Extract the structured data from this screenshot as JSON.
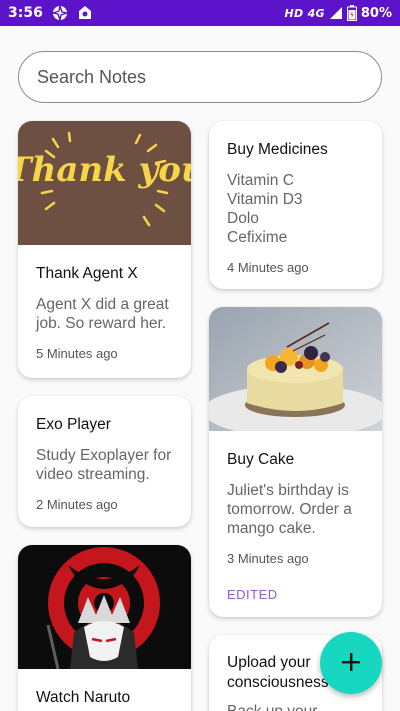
{
  "status_bar": {
    "time": "3:56",
    "network": "HD 4G",
    "battery": "80%",
    "left_icons": [
      "aperture-icon",
      "app-icon"
    ],
    "right_icons": [
      "signal-icon",
      "battery-icon"
    ]
  },
  "search": {
    "placeholder": "Search Notes",
    "value": ""
  },
  "notes": {
    "left": [
      {
        "title": "Thank Agent X",
        "content": "Agent X did a great job. So reward her.",
        "time": "5 Minutes ago",
        "image_text": "Thank you",
        "image": "thank-you-image"
      },
      {
        "title": "Exo Player",
        "content": "Study Exoplayer for video streaming.",
        "time": "2 Minutes ago"
      },
      {
        "title": "Watch Naruto",
        "image": "naruto-image"
      }
    ],
    "right": [
      {
        "title": "Buy Medicines",
        "content": "Vitamin C\nVitamin D3\nDolo\nCefixime",
        "time": "4 Minutes ago"
      },
      {
        "title": "Buy Cake",
        "content": "Juliet's birthday is tomorrow. Order a mango cake.",
        "time": "3 Minutes ago",
        "edited": "EDITED",
        "image": "cake-image"
      },
      {
        "title": "Upload your consciousness",
        "content": "Back up your"
      }
    ]
  },
  "fab": {
    "icon": "plus-icon"
  },
  "colors": {
    "status_bar": "#5b14c9",
    "fab": "#18d7c1",
    "edited": "#9b59d0"
  }
}
